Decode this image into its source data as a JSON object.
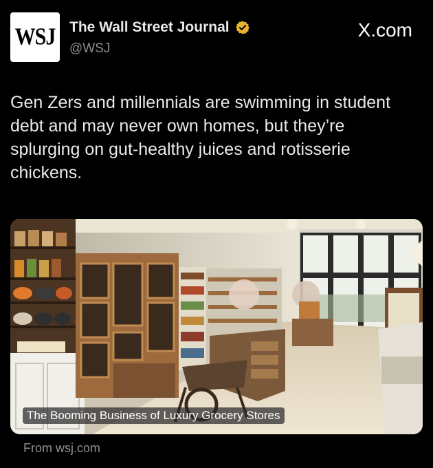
{
  "tweet": {
    "avatar_text": "WSJ",
    "author_name": "The Wall Street Journal",
    "handle": "@WSJ",
    "site": "X.com",
    "text": "Gen Zers and millennials are swimming in student debt and may never own homes, but they’re splurging on gut-healthy juices and rotisserie chickens."
  },
  "card": {
    "title": "The Booming Business of Luxury Grocery Stores",
    "source": "From wsj.com"
  },
  "colors": {
    "background": "#000000",
    "text": "#e7e9ea",
    "muted": "#8b8f94",
    "badge": "#e8b430"
  },
  "icons": {
    "verified": "verified-badge-icon",
    "logo": "x-logo-icon"
  }
}
